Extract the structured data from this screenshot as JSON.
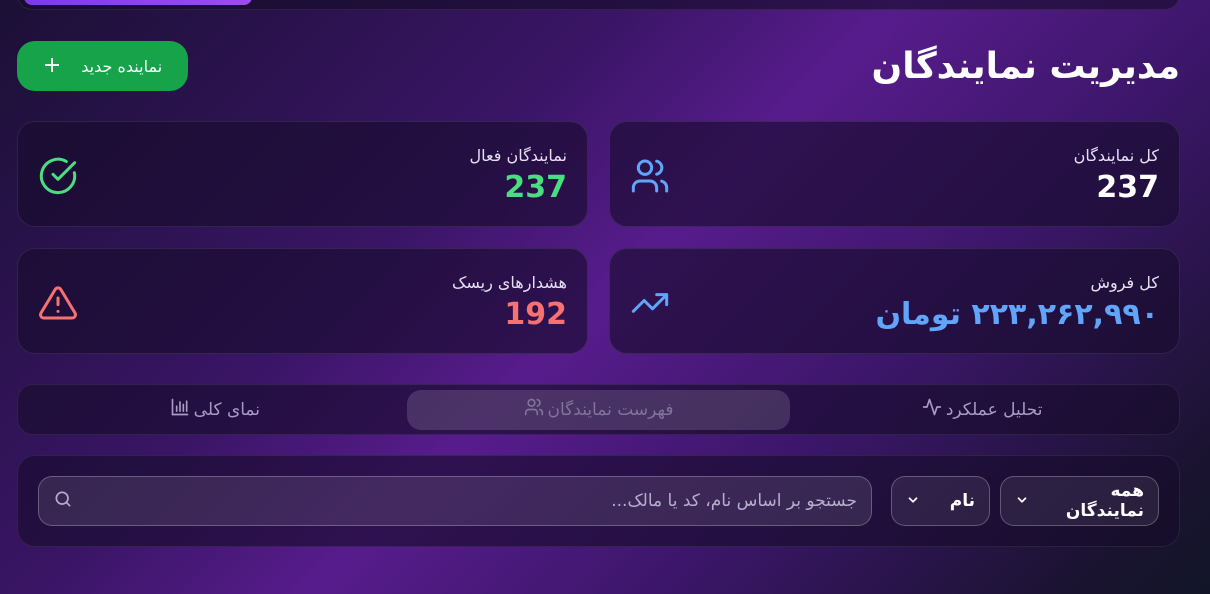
{
  "header": {
    "title": "مدیریت نمایندگان",
    "new_button_label": "نماینده جدید",
    "new_button_icon": "plus-icon"
  },
  "stats": {
    "total": {
      "label": "کل نمایندگان",
      "value": "237",
      "icon": "users-icon",
      "color": "#60a5fa"
    },
    "active": {
      "label": "نمایندگان فعال",
      "value": "237",
      "icon": "check-circle-icon",
      "color": "#4ade80"
    },
    "sales": {
      "label": "کل فروش",
      "value": "۲۲۳,۲۶۲,۹۹۰ تومان",
      "icon": "trending-up-icon",
      "color": "#60a5fa"
    },
    "risk": {
      "label": "هشدارهای ریسک",
      "value": "192",
      "icon": "alert-triangle-icon",
      "color": "#f87171"
    }
  },
  "tabs": [
    {
      "label": "تحلیل عملکرد",
      "icon": "activity-icon",
      "active": false
    },
    {
      "label": "فهرست نمایندگان",
      "icon": "users-icon",
      "active": true
    },
    {
      "label": "نمای کلی",
      "icon": "bar-chart-icon",
      "active": false
    }
  ],
  "filters": {
    "filter_value": "همه نمایندگان",
    "sort_value": "نام",
    "search_placeholder": "جستجو بر اساس نام، کد یا مالک..."
  },
  "colors": {
    "accent_green": "#16a34a",
    "tab_active_bg": "rgba(255,255,255,0.14)"
  }
}
